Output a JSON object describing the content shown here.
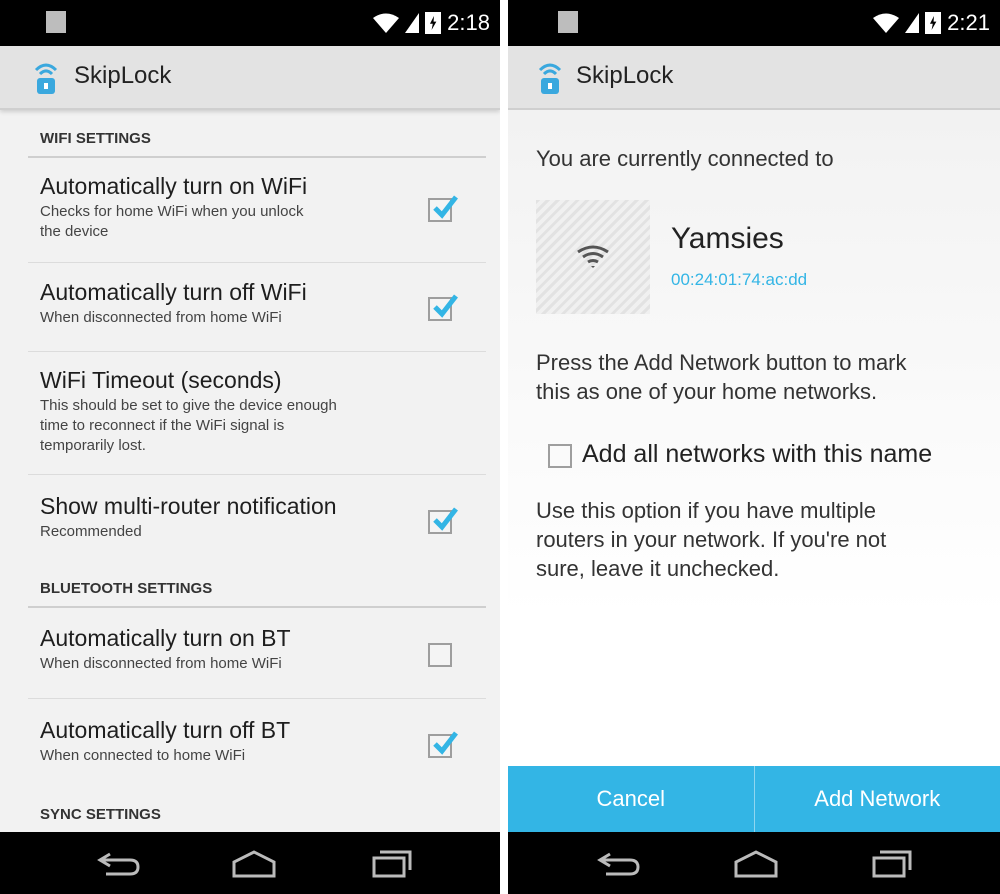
{
  "left": {
    "status_time": "2:18",
    "app_title": "SkipLock",
    "sections": [
      {
        "header": "WIFI SETTINGS"
      },
      {
        "header": "BLUETOOTH SETTINGS"
      },
      {
        "header": "SYNC SETTINGS"
      }
    ],
    "prefs": [
      {
        "title": "Automatically turn on WiFi",
        "summary_1": "Checks for home WiFi when you unlock",
        "summary_2": "the device",
        "checked": true
      },
      {
        "title": "Automatically turn off WiFi",
        "summary_1": "When disconnected from home WiFi",
        "checked": true
      },
      {
        "title": "WiFi Timeout (seconds)",
        "summary_1": "This should be set to give the device enough",
        "summary_2": "time to reconnect if the WiFi signal is",
        "summary_3": "temporarily lost."
      },
      {
        "title": "Show multi-router notification",
        "summary_1": "Recommended",
        "checked": true
      },
      {
        "title": "Automatically turn on BT",
        "summary_1": "When disconnected from home WiFi",
        "checked": false
      },
      {
        "title": "Automatically turn off BT",
        "summary_1": "When connected to home WiFi",
        "checked": true
      }
    ]
  },
  "right": {
    "status_time": "2:21",
    "app_title": "SkipLock",
    "intro": "You are currently connected to",
    "network_name": "Yamsies",
    "network_mac": "00:24:01:74:ac:dd",
    "instruction_1": "Press the Add Network button to mark",
    "instruction_2": "this as one of your home networks.",
    "add_all_label": "Add all networks with this name",
    "add_all_checked": false,
    "hint_1": "Use this option if you have multiple",
    "hint_2": "routers in your network. If you're not",
    "hint_3": "sure, leave it unchecked.",
    "cancel_label": "Cancel",
    "add_network_label": "Add Network"
  },
  "colors": {
    "accent": "#33b5e5",
    "checkbox_tick": "#33b5e5"
  },
  "icons": [
    "wifi-signal-icon",
    "cell-signal-icon",
    "battery-icon",
    "skiplock-app-icon",
    "back-icon",
    "home-icon",
    "recents-icon",
    "checkmark-icon"
  ]
}
